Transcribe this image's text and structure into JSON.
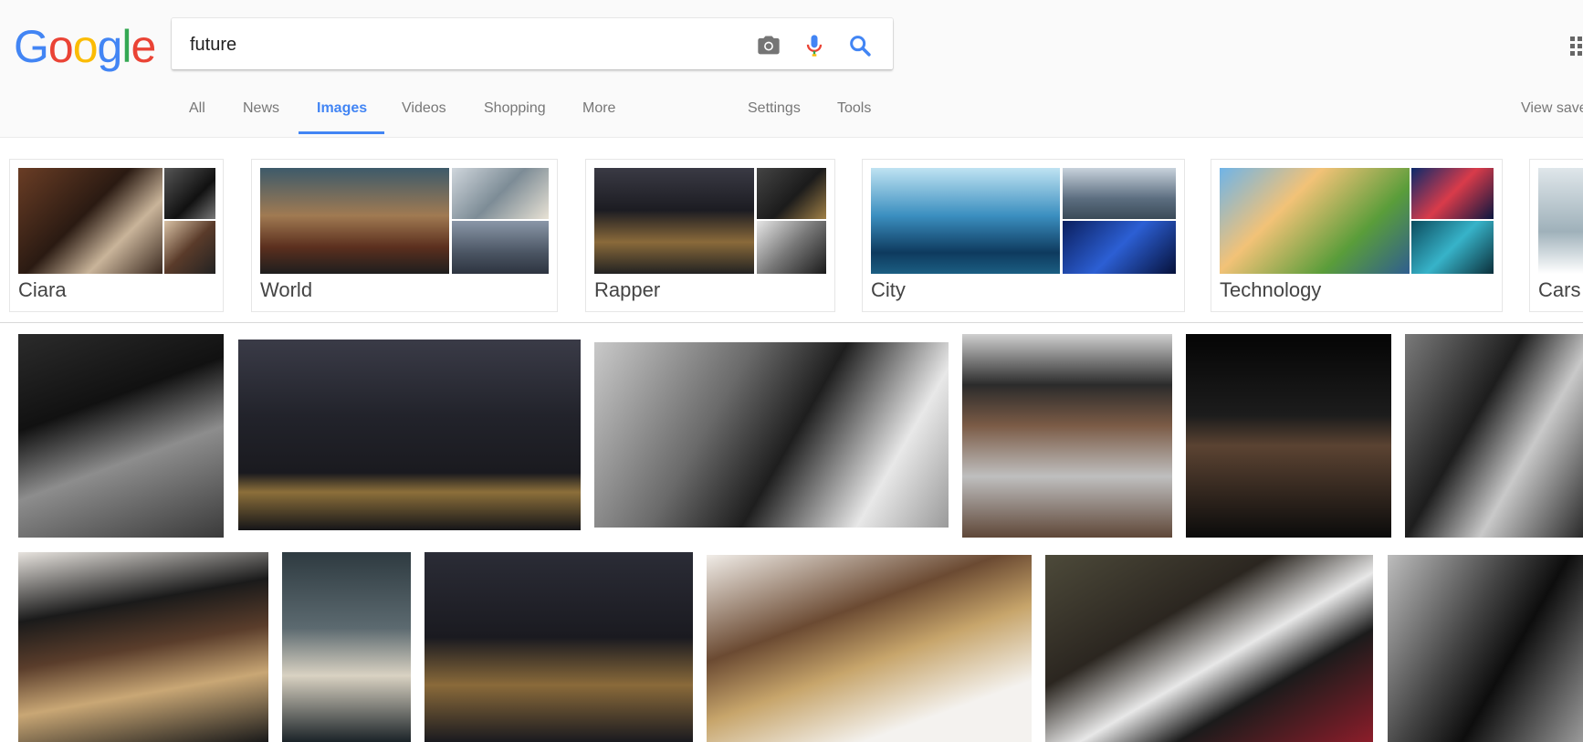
{
  "logo_text": "Google",
  "search": {
    "query": "future"
  },
  "tabs": [
    "All",
    "News",
    "Images",
    "Videos",
    "Shopping",
    "More",
    "Settings",
    "Tools"
  ],
  "active_tab": "Images",
  "view_saved": "View saved",
  "related": [
    {
      "label": "Ciara"
    },
    {
      "label": "World"
    },
    {
      "label": "Rapper"
    },
    {
      "label": "City"
    },
    {
      "label": "Technology"
    },
    {
      "label": "Cars"
    }
  ],
  "colors": {
    "accent": "#4285f4",
    "logo_blue": "#4285f4",
    "logo_red": "#ea4335",
    "logo_yellow": "#fbbc05",
    "logo_green": "#34a853"
  }
}
